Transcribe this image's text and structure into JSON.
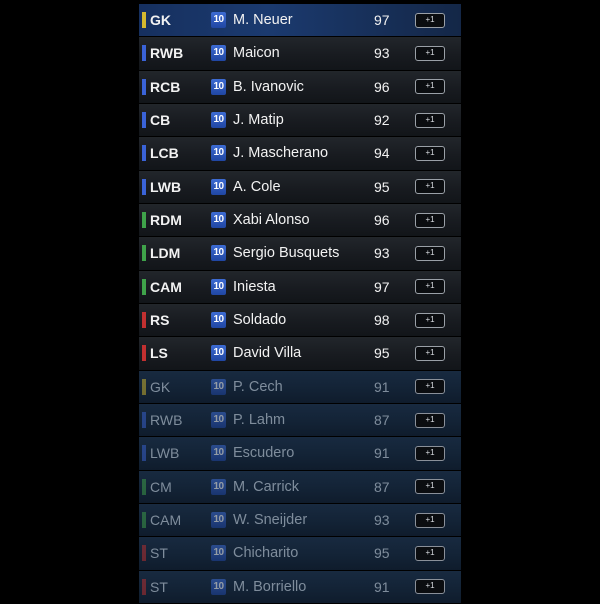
{
  "colors": {
    "gk": "#d4b92e",
    "def": "#3a63d8",
    "mid": "#3fa34a",
    "att": "#c23030"
  },
  "badge_label": "10",
  "action_label": "+1",
  "players": [
    {
      "pos": "GK",
      "name": "M. Neuer",
      "rating": "97",
      "group": "gk",
      "status": "selected"
    },
    {
      "pos": "RWB",
      "name": "Maicon",
      "rating": "93",
      "group": "def",
      "status": "starter"
    },
    {
      "pos": "RCB",
      "name": "B. Ivanovic",
      "rating": "96",
      "group": "def",
      "status": "starter"
    },
    {
      "pos": "CB",
      "name": "J. Matip",
      "rating": "92",
      "group": "def",
      "status": "starter"
    },
    {
      "pos": "LCB",
      "name": "J. Mascherano",
      "rating": "94",
      "group": "def",
      "status": "starter"
    },
    {
      "pos": "LWB",
      "name": "A. Cole",
      "rating": "95",
      "group": "def",
      "status": "starter"
    },
    {
      "pos": "RDM",
      "name": "Xabi Alonso",
      "rating": "96",
      "group": "mid",
      "status": "starter"
    },
    {
      "pos": "LDM",
      "name": "Sergio Busquets",
      "rating": "93",
      "group": "mid",
      "status": "starter"
    },
    {
      "pos": "CAM",
      "name": "Iniesta",
      "rating": "97",
      "group": "mid",
      "status": "starter"
    },
    {
      "pos": "RS",
      "name": "Soldado",
      "rating": "98",
      "group": "att",
      "status": "starter"
    },
    {
      "pos": "LS",
      "name": "David Villa",
      "rating": "95",
      "group": "att",
      "status": "starter"
    },
    {
      "pos": "GK",
      "name": "P. Cech",
      "rating": "91",
      "group": "gk",
      "status": "sub"
    },
    {
      "pos": "RWB",
      "name": "P. Lahm",
      "rating": "87",
      "group": "def",
      "status": "sub"
    },
    {
      "pos": "LWB",
      "name": "Escudero",
      "rating": "91",
      "group": "def",
      "status": "sub"
    },
    {
      "pos": "CM",
      "name": "M. Carrick",
      "rating": "87",
      "group": "mid",
      "status": "sub"
    },
    {
      "pos": "CAM",
      "name": "W. Sneijder",
      "rating": "93",
      "group": "mid",
      "status": "sub"
    },
    {
      "pos": "ST",
      "name": "Chicharito",
      "rating": "95",
      "group": "att",
      "status": "sub"
    },
    {
      "pos": "ST",
      "name": "M. Borriello",
      "rating": "91",
      "group": "att",
      "status": "sub"
    }
  ]
}
